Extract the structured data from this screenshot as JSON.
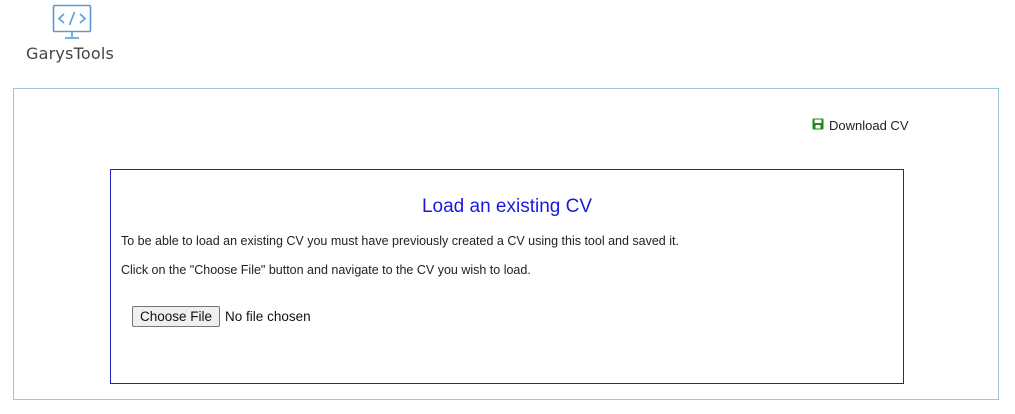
{
  "brand": {
    "name": "GarysTools",
    "icon": "code-monitor-icon"
  },
  "toolbar": {
    "download_label": "Download CV",
    "download_icon": "save-icon",
    "download_icon_color": "#1a8a1a"
  },
  "load_panel": {
    "title": "Load an existing CV",
    "paragraph1": "To be able to load an existing CV you must have previously created a CV using this tool and saved it.",
    "paragraph2": "Click on the \"Choose File\" button and navigate to the CV you wish to load.",
    "choose_file_label": "Choose File",
    "file_status": "No file chosen"
  },
  "colors": {
    "title": "#1a1adb",
    "inner_border": "#2020c0",
    "outer_border": "#9cc9e2",
    "logo_blue": "#5b9bd5"
  }
}
